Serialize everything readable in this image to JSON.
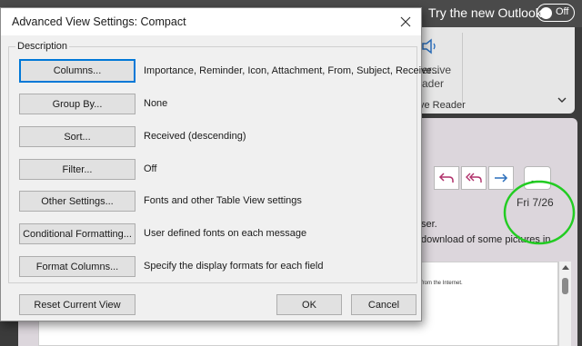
{
  "background": {
    "try_new_outlook": "Try the new Outlook",
    "toggle_label": "Off",
    "ribbon_text_1": "ersive",
    "ribbon_text_2": "ader",
    "ribbon_group": "ve Reader",
    "left_edge_1": "S",
    "left_edge_2": "u",
    "left_edge_3": "G",
    "date": "Fri 7/26",
    "info_line_1": "ser.",
    "info_line_2": "download of some pictures in",
    "message_snippet": "from the Internet.",
    "more_button": "..."
  },
  "dialog": {
    "title": "Advanced View Settings: Compact",
    "group_label": "Description",
    "rows": [
      {
        "button": "Columns...",
        "description": "Importance, Reminder, Icon, Attachment, From, Subject, Receive..."
      },
      {
        "button": "Group By...",
        "description": "None"
      },
      {
        "button": "Sort...",
        "description": "Received (descending)"
      },
      {
        "button": "Filter...",
        "description": "Off"
      },
      {
        "button": "Other Settings...",
        "description": "Fonts and other Table View settings"
      },
      {
        "button": "Conditional Formatting...",
        "description": "User defined fonts on each message"
      },
      {
        "button": "Format Columns...",
        "description": "Specify the display formats for each field"
      }
    ],
    "reset_button": "Reset Current View",
    "ok_button": "OK",
    "cancel_button": "Cancel"
  },
  "colors": {
    "focus_border": "#0078d7",
    "highlight_circle": "#22cc22",
    "reply_arrows": "#b0306a",
    "forward_arrow": "#2a6ebb"
  },
  "icons": [
    "close-icon",
    "toggle-icon",
    "speaker-icon",
    "chevron-down-icon",
    "reply-icon",
    "reply-all-icon",
    "forward-icon"
  ]
}
